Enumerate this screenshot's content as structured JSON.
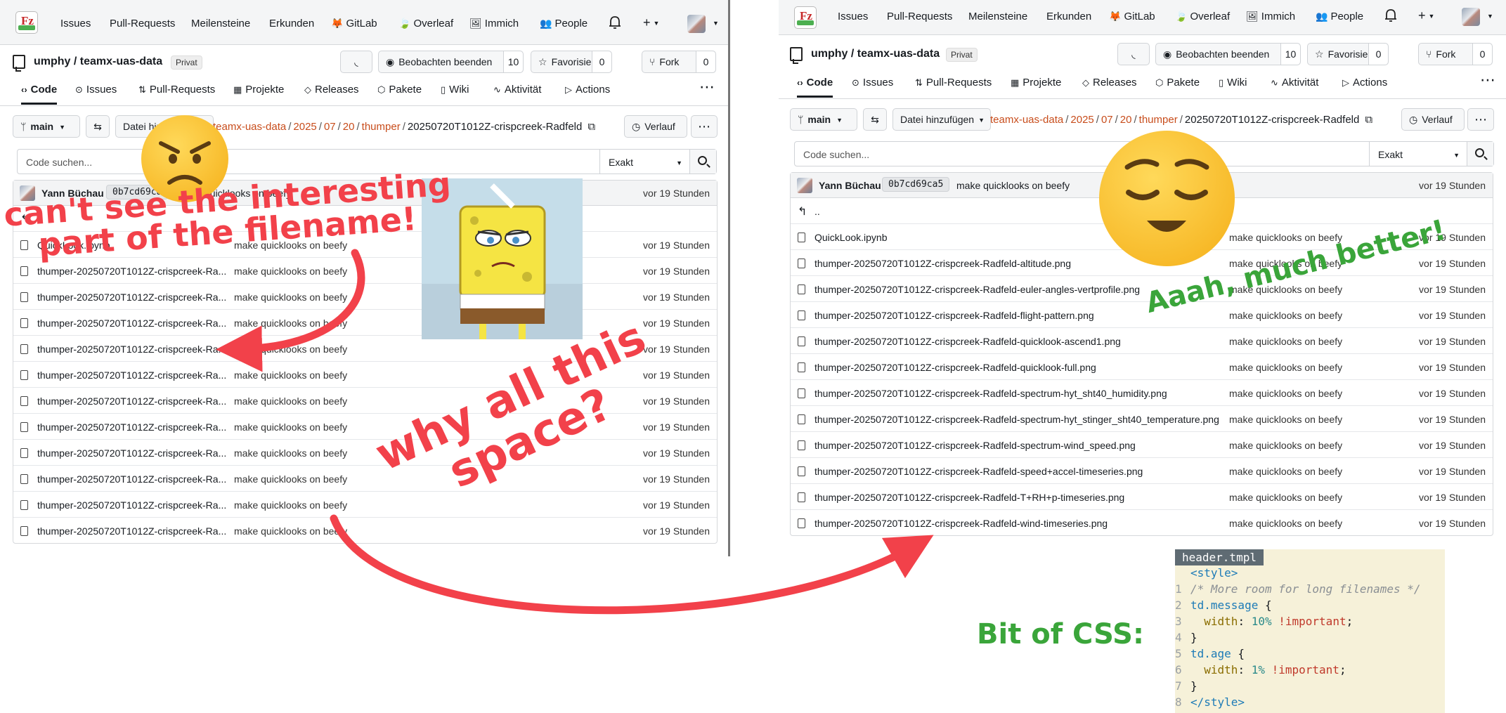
{
  "nav": {
    "items": [
      "Issues",
      "Pull-Requests",
      "Meilensteine",
      "Erkunden"
    ],
    "links": [
      {
        "icon": "gitlab-fox-icon",
        "glyph": "🦊",
        "label": "GitLab"
      },
      {
        "icon": "overleaf-leaf-icon",
        "glyph": "🍃",
        "label": "Overleaf"
      },
      {
        "icon": "immich-image-icon",
        "glyph": "🖼",
        "label": "Immich"
      },
      {
        "icon": "people-icon",
        "glyph": "👥",
        "label": "People"
      }
    ],
    "plus": "+"
  },
  "repo": {
    "owner_repo": "umphy / teamx-uas-data",
    "visibility": "Privat",
    "watch_label": "Beobachten beenden",
    "watch_count": "10",
    "star_label": "Favorisieren",
    "star_count": "0",
    "fork_label": "Fork",
    "fork_count": "0"
  },
  "tabs": [
    {
      "icon": "code-icon",
      "glyph": "‹›",
      "label": "Code"
    },
    {
      "icon": "issues-icon",
      "glyph": "⊙",
      "label": "Issues"
    },
    {
      "icon": "pull-request-icon",
      "glyph": "⇅",
      "label": "Pull-Requests"
    },
    {
      "icon": "projects-icon",
      "glyph": "▦",
      "label": "Projekte"
    },
    {
      "icon": "tag-icon",
      "glyph": "◇",
      "label": "Releases"
    },
    {
      "icon": "package-icon",
      "glyph": "⬡",
      "label": "Pakete"
    },
    {
      "icon": "book-icon",
      "glyph": "▯",
      "label": "Wiki"
    },
    {
      "icon": "activity-icon",
      "glyph": "∿",
      "label": "Aktivität"
    },
    {
      "icon": "play-icon",
      "glyph": "▷",
      "label": "Actions"
    }
  ],
  "branch": "main",
  "add_file": "Datei hinzufügen",
  "breadcrumb": {
    "parts": [
      "teamx-uas-data",
      "2025",
      "07",
      "20",
      "thumper"
    ],
    "current": "20250720T1012Z-crispcreek-Radfeld"
  },
  "history_label": "Verlauf",
  "search": {
    "placeholder": "Code suchen...",
    "mode": "Exakt"
  },
  "commit": {
    "author": "Yann Büchau",
    "sha": "0b7cd69ca5",
    "sha_left_clipped": "0b7cd69ca",
    "message": "make quicklooks on beefy",
    "message_left_clipped": "quicklooks on beefy",
    "age": "vor 19 Stunden"
  },
  "up_dir": "..",
  "files_full": [
    "QuickLook.ipynb",
    "thumper-20250720T1012Z-crispcreek-Radfeld-altitude.png",
    "thumper-20250720T1012Z-crispcreek-Radfeld-euler-angles-vertprofile.png",
    "thumper-20250720T1012Z-crispcreek-Radfeld-flight-pattern.png",
    "thumper-20250720T1012Z-crispcreek-Radfeld-quicklook-ascend1.png",
    "thumper-20250720T1012Z-crispcreek-Radfeld-quicklook-full.png",
    "thumper-20250720T1012Z-crispcreek-Radfeld-spectrum-hyt_sht40_humidity.png",
    "thumper-20250720T1012Z-crispcreek-Radfeld-spectrum-hyt_stinger_sht40_temperature.png",
    "thumper-20250720T1012Z-crispcreek-Radfeld-spectrum-wind_speed.png",
    "thumper-20250720T1012Z-crispcreek-Radfeld-speed+accel-timeseries.png",
    "thumper-20250720T1012Z-crispcreek-Radfeld-T+RH+p-timeseries.png",
    "thumper-20250720T1012Z-crispcreek-Radfeld-wind-timeseries.png"
  ],
  "files_truncated": [
    "QuickLook.ipynb",
    "thumper-20250720T1012Z-crispcreek-Ra...",
    "thumper-20250720T1012Z-crispcreek-Ra...",
    "thumper-20250720T1012Z-crispcreek-Ra...",
    "thumper-20250720T1012Z-crispcreek-Ra...",
    "thumper-20250720T1012Z-crispcreek-Ra...",
    "thumper-20250720T1012Z-crispcreek-Ra...",
    "thumper-20250720T1012Z-crispcreek-Ra...",
    "thumper-20250720T1012Z-crispcreek-Ra...",
    "thumper-20250720T1012Z-crispcreek-Ra...",
    "thumper-20250720T1012Z-crispcreek-Ra...",
    "thumper-20250720T1012Z-crispcreek-Ra..."
  ],
  "annotations": {
    "complaint_line1": "can't see the interesting",
    "complaint_line2": "part of the filename!",
    "why_line1": "why all this",
    "why_line2": "space?",
    "better": "Aaah, much better!",
    "css_label": "Bit of CSS:",
    "red": "#f2414a",
    "green": "#3aa53a"
  },
  "code": {
    "filename": "header.tmpl",
    "lines": [
      {
        "n": "",
        "t": "<style>"
      },
      {
        "n": "1",
        "t": "/* More room for long filenames */"
      },
      {
        "n": "2",
        "t": "td.message {"
      },
      {
        "n": "3",
        "t": "  width: 10% !important;"
      },
      {
        "n": "4",
        "t": "}"
      },
      {
        "n": "5",
        "t": "td.age {"
      },
      {
        "n": "6",
        "t": "  width: 1% !important;"
      },
      {
        "n": "7",
        "t": "}"
      },
      {
        "n": "8",
        "t": "</style>"
      }
    ]
  },
  "colors": {
    "link": "#c84d1c",
    "accent": "#181c21"
  }
}
